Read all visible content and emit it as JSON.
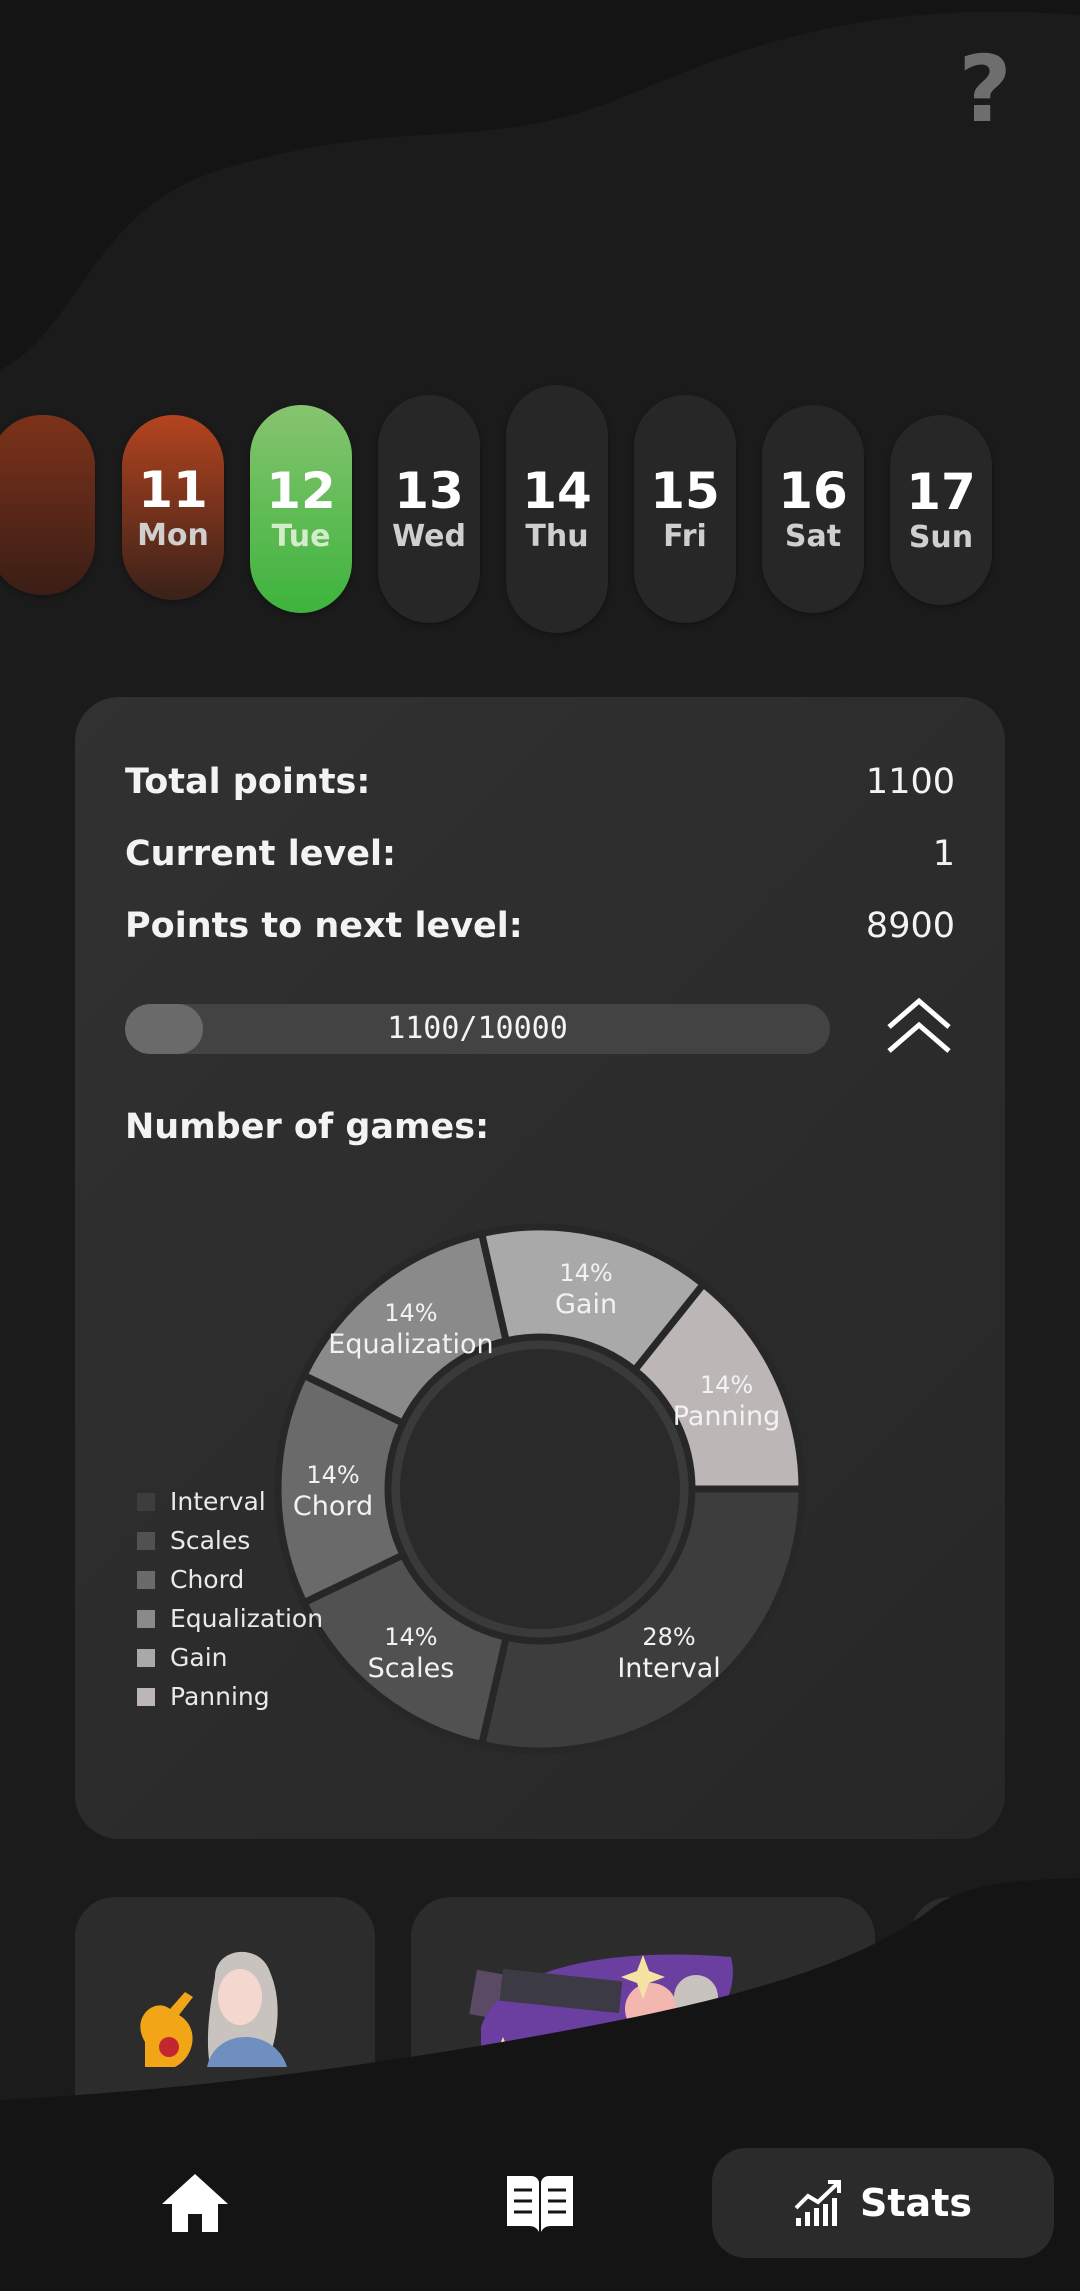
{
  "help_symbol": "?",
  "days": [
    {
      "num": "11",
      "name": "Mon",
      "state": "missed"
    },
    {
      "num": "12",
      "name": "Tue",
      "state": "today"
    },
    {
      "num": "13",
      "name": "Wed",
      "state": "upcoming"
    },
    {
      "num": "14",
      "name": "Thu",
      "state": "upcoming"
    },
    {
      "num": "15",
      "name": "Fri",
      "state": "upcoming"
    },
    {
      "num": "16",
      "name": "Sat",
      "state": "upcoming"
    },
    {
      "num": "17",
      "name": "Sun",
      "state": "upcoming"
    }
  ],
  "stats": {
    "total_points_label": "Total points:",
    "total_points_value": "1100",
    "current_level_label": "Current level:",
    "current_level_value": "1",
    "next_level_label": "Points to next level:",
    "next_level_value": "8900",
    "progress_text": "1100/10000",
    "progress_fraction": 0.11,
    "games_title": "Number of games:"
  },
  "legend": [
    {
      "label": "Interval",
      "color": "#3d3d3d"
    },
    {
      "label": "Scales",
      "color": "#515151"
    },
    {
      "label": "Chord",
      "color": "#6a6a6a"
    },
    {
      "label": "Equalization",
      "color": "#8a8a8a"
    },
    {
      "label": "Gain",
      "color": "#a9a9a9"
    },
    {
      "label": "Panning",
      "color": "#bcb6b6"
    }
  ],
  "chart_data": {
    "type": "pie",
    "variant": "donut",
    "slices": [
      {
        "label": "Interval",
        "percent": "28%",
        "value": 28
      },
      {
        "label": "Scales",
        "percent": "14%",
        "value": 14
      },
      {
        "label": "Chord",
        "percent": "14%",
        "value": 14
      },
      {
        "label": "Equalization",
        "percent": "14%",
        "value": 14
      },
      {
        "label": "Gain",
        "percent": "14%",
        "value": 14
      },
      {
        "label": "Panning",
        "percent": "14%",
        "value": 14
      }
    ]
  },
  "nav": {
    "home_icon": "home-icon",
    "book_icon": "book-icon",
    "stats_icon": "chart-up-icon",
    "stats_label": "Stats"
  }
}
